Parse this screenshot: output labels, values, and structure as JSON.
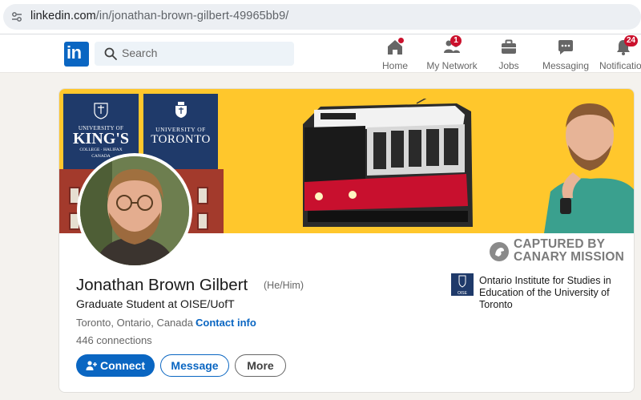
{
  "browser": {
    "url_host": "linkedin.com",
    "url_path": "/in/jonathan-brown-gilbert-49965bb9/"
  },
  "nav": {
    "logo_text": "in",
    "search_placeholder": "Search",
    "items": [
      {
        "label": "Home",
        "icon": "home-icon",
        "badge": ""
      },
      {
        "label": "My Network",
        "icon": "network-icon",
        "badge": "1"
      },
      {
        "label": "Jobs",
        "icon": "briefcase-icon",
        "badge": ""
      },
      {
        "label": "Messaging",
        "icon": "message-icon",
        "badge": ""
      },
      {
        "label": "Notifications",
        "icon": "bell-icon",
        "badge": "24"
      }
    ]
  },
  "banner": {
    "kings_logo": {
      "line1": "UNIVERSITY OF",
      "line2": "KING'S",
      "line3": "COLLEGE · HALIFAX",
      "line4": "CANADA"
    },
    "uoft_logo": {
      "line1": "UNIVERSITY OF",
      "line2": "TORONTO"
    }
  },
  "overlay": {
    "line1": "CAPTURED BY",
    "line2": "CANARY MISSION"
  },
  "profile": {
    "name": "Jonathan Brown Gilbert",
    "pronouns": "(He/Him)",
    "headline": "Graduate Student at OISE/UofT",
    "location": "Toronto, Ontario, Canada",
    "separator": "·",
    "contact_label": "Contact info",
    "connections": "446 connections"
  },
  "education": {
    "logo_text": "OISE",
    "name": "Ontario Institute for Studies in Education of the University of Toronto"
  },
  "actions": {
    "connect_label": "Connect",
    "message_label": "Message",
    "more_label": "More"
  },
  "colors": {
    "brand_blue": "#0a66c2",
    "banner_yellow": "#ffc72c",
    "badge_red": "#cb112d",
    "navy": "#1f3a6a"
  }
}
